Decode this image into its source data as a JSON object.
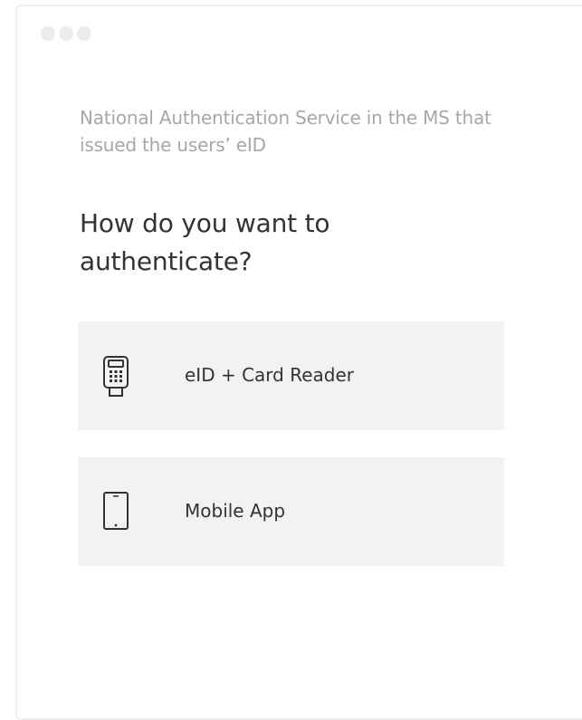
{
  "window": {
    "controls": [
      "dot",
      "dot",
      "dot"
    ]
  },
  "auth_service": {
    "subtitle": "National Authentication Service in the MS that issued the users’ eID"
  },
  "prompt": {
    "heading": "How do you want to authenticate?"
  },
  "options": [
    {
      "label": "eID + Card Reader",
      "icon": "card-reader-icon"
    },
    {
      "label": "Mobile App",
      "icon": "mobile-phone-icon"
    }
  ],
  "colors": {
    "panel_bg": "#f2f2f2",
    "text_primary": "#333333",
    "text_muted": "#a7a7a7",
    "window_dot": "#ececec"
  }
}
